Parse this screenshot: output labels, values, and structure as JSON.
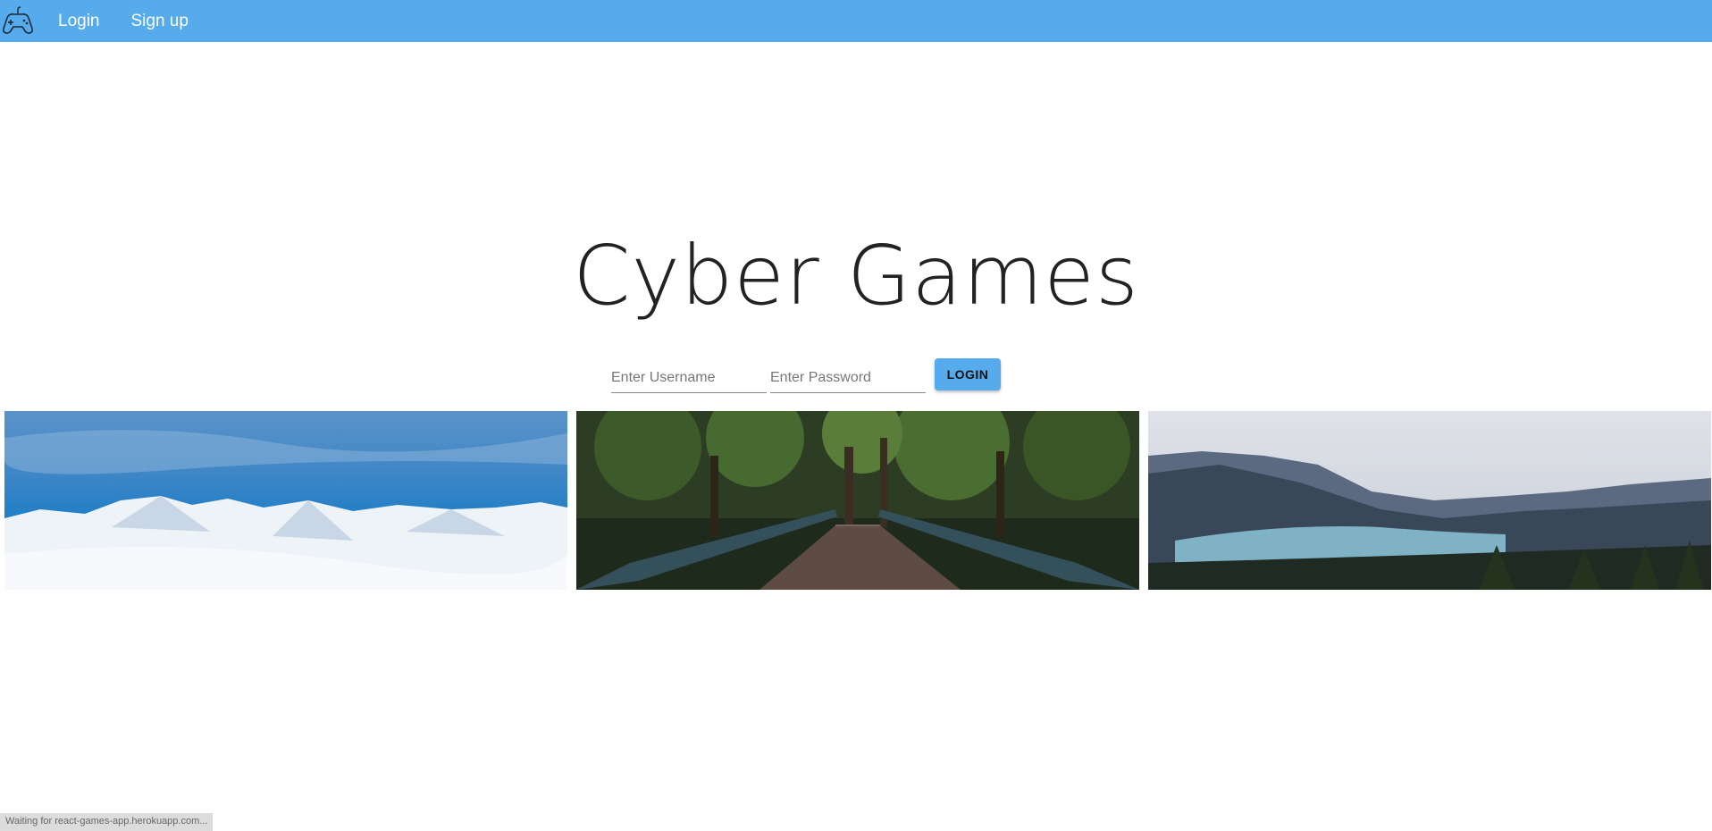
{
  "nav": {
    "logo_icon": "gamepad-icon",
    "links": [
      {
        "label": "Login"
      },
      {
        "label": "Sign up"
      }
    ]
  },
  "hero": {
    "title": "Cyber Games"
  },
  "login_form": {
    "username_placeholder": "Enter Username",
    "username_value": "",
    "password_placeholder": "Enter Password",
    "password_value": "",
    "button_label": "LOGIN"
  },
  "gallery": {
    "images": [
      {
        "subject": "snowy-mountains-photo"
      },
      {
        "subject": "forest-bridge-photo"
      },
      {
        "subject": "mountain-lake-photo"
      }
    ]
  },
  "status_bar": {
    "text": "Waiting for react-games-app.herokuapp.com..."
  },
  "colors": {
    "topbar": "#55abec",
    "button": "#55abec",
    "title_text": "#222222"
  }
}
